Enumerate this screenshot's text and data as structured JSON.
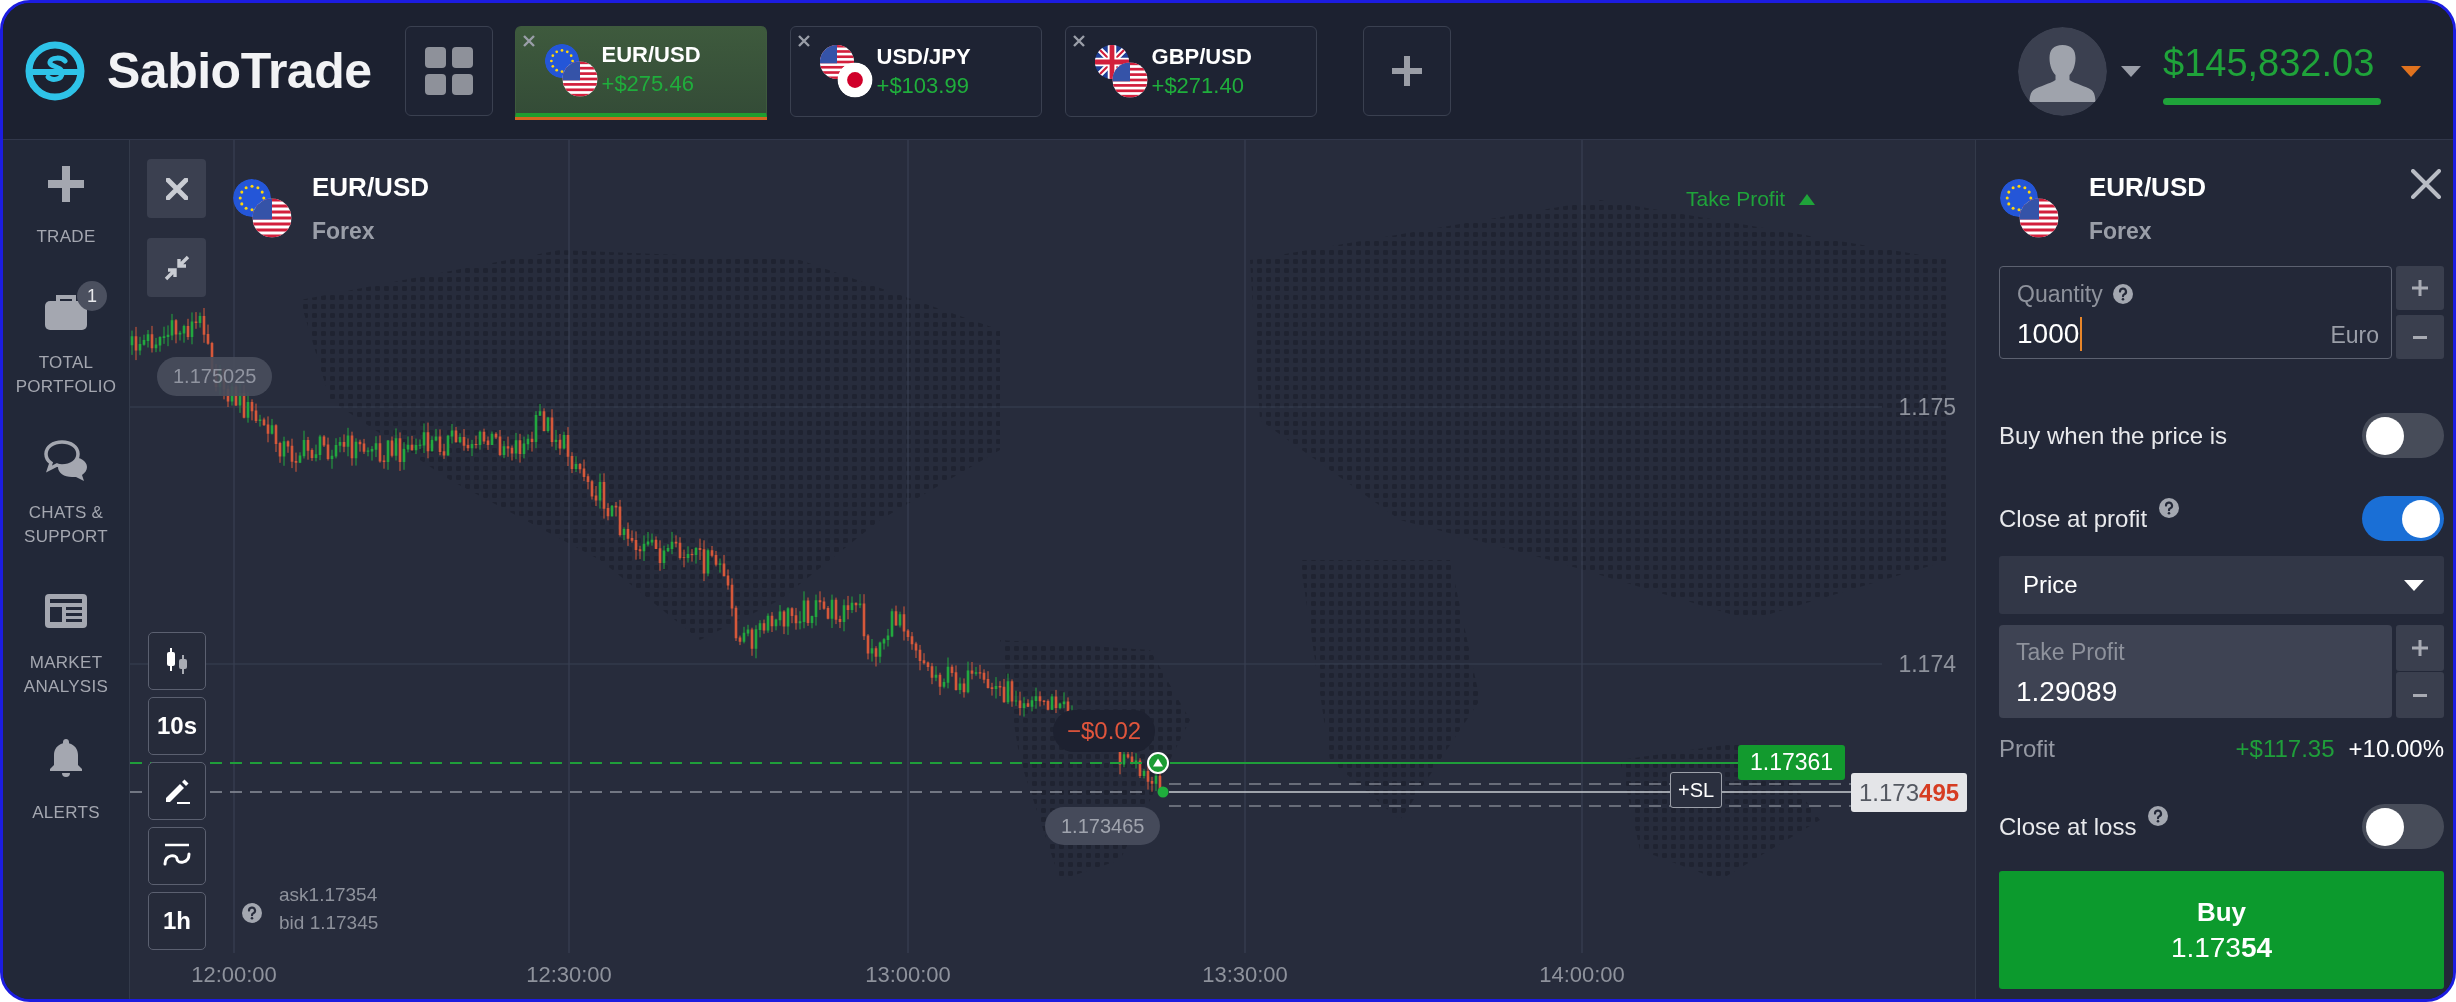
{
  "header": {
    "logo": "SabioTrade",
    "tabs": [
      {
        "symbol": "EUR/USD",
        "profit": "+$275.46",
        "kind": "eurusd",
        "selected": true
      },
      {
        "symbol": "USD/JPY",
        "profit": "+$103.99",
        "kind": "usdjpy",
        "selected": false
      },
      {
        "symbol": "GBP/USD",
        "profit": "+$271.40",
        "kind": "gbpusd",
        "selected": false
      }
    ],
    "balance": "$145,832.03"
  },
  "sidebar": {
    "items": [
      {
        "label": "TRADE",
        "kind": "trade"
      },
      {
        "label": "TOTAL PORTFOLIO",
        "kind": "portfolio",
        "badge": "1"
      },
      {
        "label": "CHATS & SUPPORT",
        "kind": "chats"
      },
      {
        "label": "MARKET ANALYSIS",
        "kind": "analysis"
      },
      {
        "label": "ALERTS",
        "kind": "alerts"
      }
    ]
  },
  "chart": {
    "symbol": "EUR/USD",
    "kind": "eurusd",
    "category": "Forex",
    "take_profit_marker": "Take Profit",
    "price_axis": [
      "1.175",
      "1.174"
    ],
    "time_axis": [
      "12:00:00",
      "12:30:00",
      "13:00:00",
      "13:30:00",
      "14:00:00"
    ],
    "high_label": "1.175025",
    "position_pnl": "−$0.02",
    "low_label": "1.173465",
    "open_price": "1.17361",
    "stop_loss_button": "+SL",
    "current_price": "1.173**495**",
    "tools": [
      {
        "kind": "candles"
      },
      {
        "kind": "interval",
        "label": "10s"
      },
      {
        "kind": "draw"
      },
      {
        "kind": "indicators"
      },
      {
        "kind": "interval",
        "label": "1h"
      }
    ],
    "ask": "ask1.17354",
    "bid": "bid 1.17345"
  },
  "order": {
    "symbol": "EUR/USD",
    "kind": "eurusd",
    "category": "Forex",
    "quantity": {
      "label": "Quantity",
      "help": true,
      "value": "1000",
      "unit": "Euro"
    },
    "buy_when_price": {
      "label": "Buy when the price is",
      "on": false
    },
    "close_at_profit": {
      "label": "Close at profit",
      "help": true,
      "on": true
    },
    "profit_mode": "Price",
    "take_profit": {
      "label": "Take Profit",
      "value": "1.29089"
    },
    "profit": {
      "label": "Profit",
      "amount": "+$117.35",
      "percent": "+10.00%"
    },
    "close_at_loss": {
      "label": "Close at loss",
      "help": true,
      "on": false
    },
    "buy": {
      "label": "Buy",
      "price": "1.173**54**"
    }
  }
}
